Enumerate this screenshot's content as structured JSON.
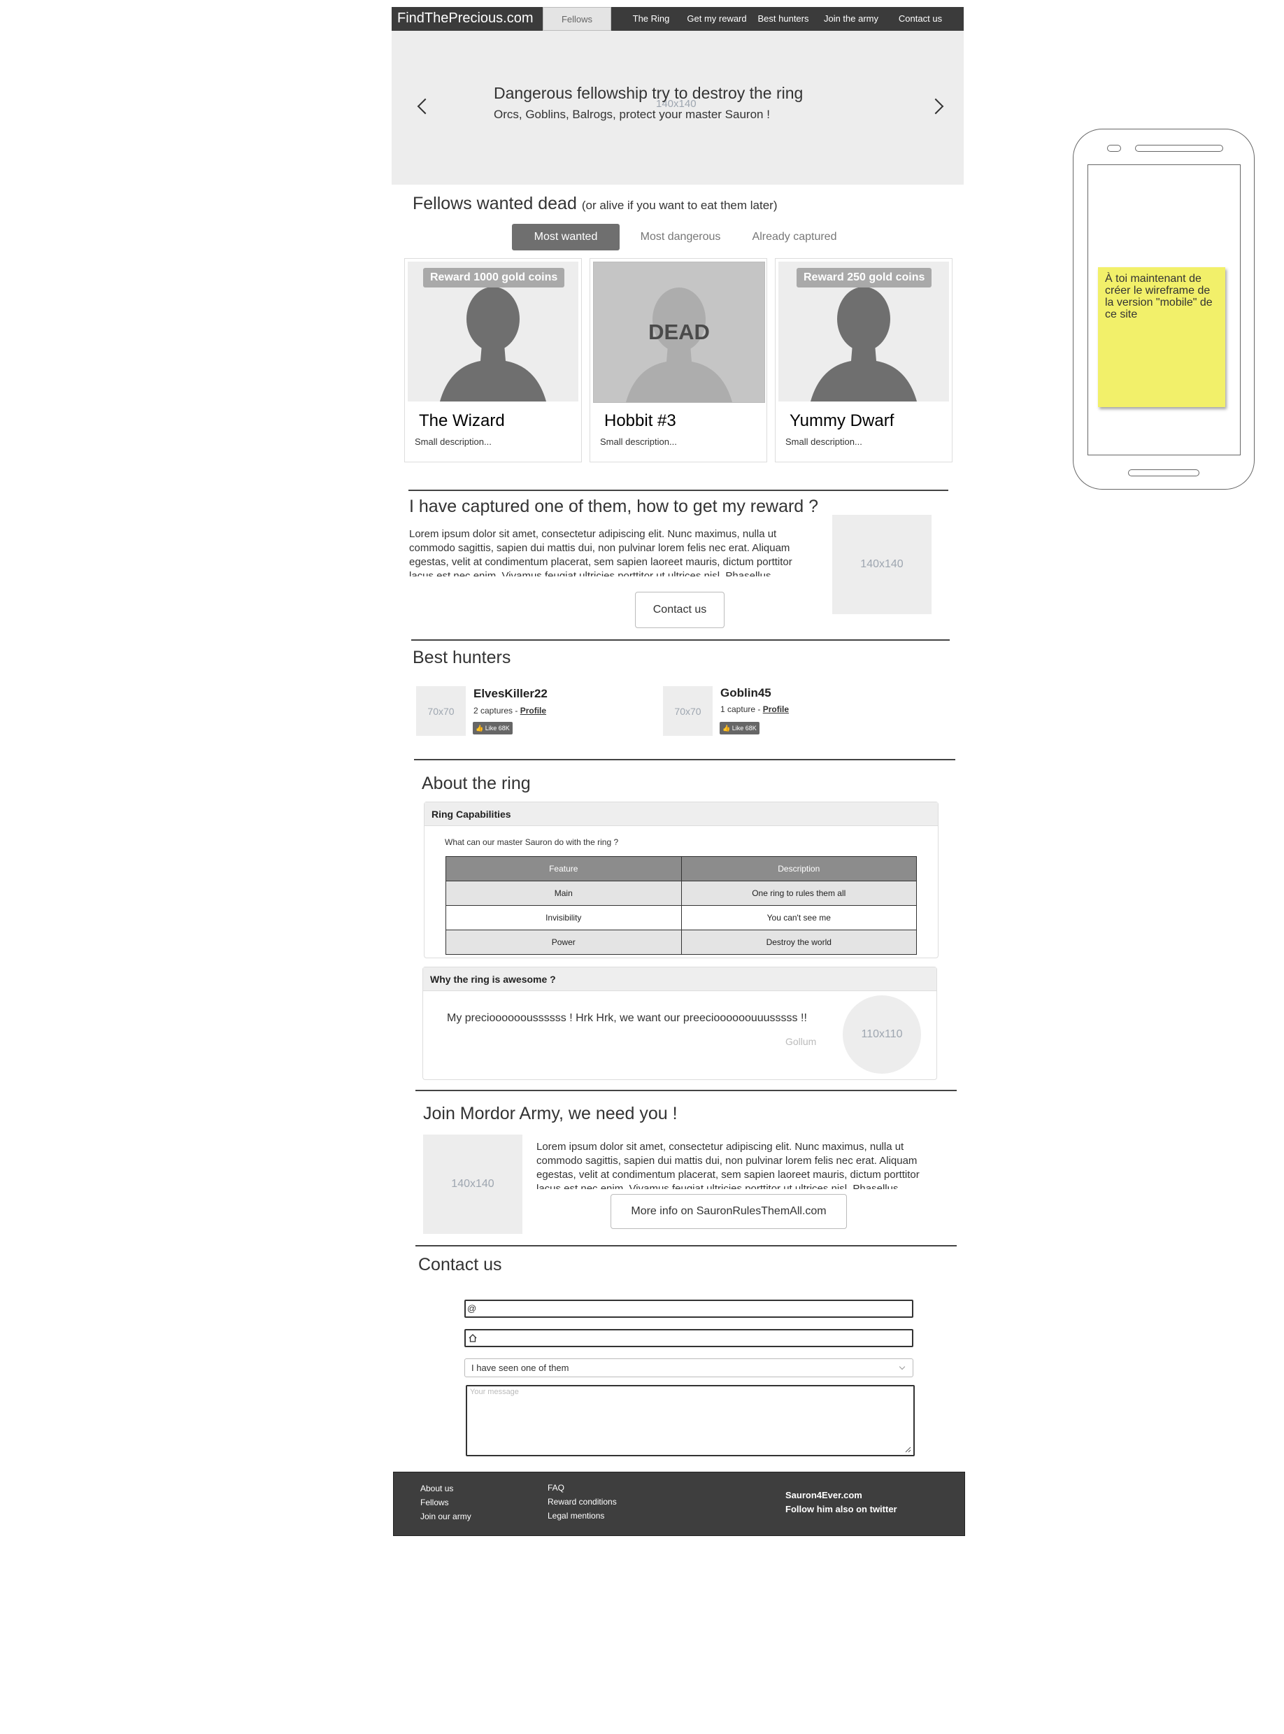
{
  "nav": {
    "brand": "FindThePrecious.com",
    "items": [
      "Fellows",
      "The Ring",
      "Get my reward",
      "Best hunters",
      "Join the army",
      "Contact us"
    ]
  },
  "carousel": {
    "placeholder": "140x140",
    "title": "Dangerous fellowship try to destroy the ring",
    "subtitle": "Orcs, Goblins, Balrogs, protect your master Sauron !"
  },
  "fellows": {
    "heading": "Fellows wanted dead",
    "heading_note": "(or alive if you want to eat them later)",
    "tabs": [
      "Most wanted",
      "Most dangerous",
      "Already captured"
    ],
    "cards": [
      {
        "badge": "Reward 1000 gold coins",
        "title": "The Wizard",
        "desc": "Small description..."
      },
      {
        "overlay": "DEAD",
        "title": "Hobbit #3",
        "desc": "Small description..."
      },
      {
        "badge": "Reward 250 gold coins",
        "title": "Yummy Dwarf",
        "desc": "Small description..."
      }
    ]
  },
  "reward": {
    "heading": "I have captured one of them, how to get my reward ?",
    "text": "Lorem ipsum dolor sit amet, consectetur adipiscing elit. Nunc maximus, nulla ut commodo sagittis, sapien dui mattis dui, non pulvinar lorem felis nec erat. Aliquam egestas, velit at condimentum placerat, sem sapien laoreet mauris, dictum porttitor lacus est nec enim. Vivamus feugiat ultricies porttitor ut ultrices nisl. Phasellus",
    "image": "140x140",
    "button": "Contact us"
  },
  "hunters": {
    "heading": "Best hunters",
    "list": [
      {
        "avatar": "70x70",
        "name": "ElvesKiller22",
        "captures": "2 captures - ",
        "profile": "Profile",
        "like": "Like 68K"
      },
      {
        "avatar": "70x70",
        "name": "Goblin45",
        "captures": "1 capture - ",
        "profile": "Profile",
        "like": "Like 68K"
      }
    ]
  },
  "ring": {
    "heading": "About the ring",
    "capabilities": {
      "title": "Ring Capabilities",
      "question": "What can our master Sauron do with the ring ?",
      "columns": [
        "Feature",
        "Description"
      ],
      "rows": [
        [
          "Main",
          "One ring to rules them all"
        ],
        [
          "Invisibility",
          "You can't see me"
        ],
        [
          "Power",
          "Destroy the world"
        ]
      ]
    },
    "awesome": {
      "title": "Why the ring is awesome ?",
      "quote": "My preciooooooussssss ! Hrk Hrk, we want our preecioooooouuusssss !!",
      "author": "Gollum",
      "image": "110x110"
    }
  },
  "army": {
    "heading": "Join Mordor Army, we need you !",
    "image": "140x140",
    "text": "Lorem ipsum dolor sit amet, consectetur adipiscing elit. Nunc maximus, nulla ut commodo sagittis, sapien dui mattis dui, non pulvinar lorem felis nec erat. Aliquam egestas, velit at condimentum placerat, sem sapien laoreet mauris, dictum porttitor lacus est nec enim. Vivamus feugiat ultricies porttitor ut ultrices nisl. Phasellus",
    "button": "More info on SauronRulesThemAll.com"
  },
  "contact": {
    "heading": "Contact us",
    "email_icon": "@",
    "home_icon": "home-icon",
    "select_value": "I have seen one of them",
    "message_placeholder": "Your message"
  },
  "footer": {
    "col1": [
      "About us",
      "Fellows",
      "Join our army"
    ],
    "col2": [
      "FAQ",
      "Reward conditions",
      "Legal mentions"
    ],
    "col3": [
      "Sauron4Ever.com",
      "Follow him also on twitter"
    ]
  },
  "sticky": {
    "note": "À toi maintenant de créer le wireframe de la version \"mobile\" de ce site"
  }
}
